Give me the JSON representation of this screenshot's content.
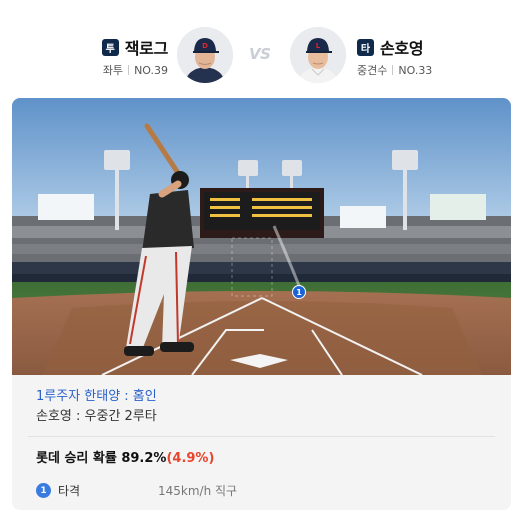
{
  "matchup": {
    "pitcher": {
      "role": "투",
      "name": "잭로그",
      "position": "좌투",
      "number": "NO.39",
      "cap_color": "#1b2a4a"
    },
    "vs": "VS",
    "batter": {
      "role": "타",
      "name": "손호영",
      "position": "중견수",
      "number": "NO.33",
      "cap_color": "#1b2a4a"
    }
  },
  "play": {
    "runner_text": "1루주자 한태양 : 홈인",
    "result_text": "손호영 : 우중간 2루타",
    "win_prob_label": "롯데 승리 확률 89.2%",
    "win_prob_delta": "(4.9%)",
    "pitch_marker": "1",
    "pitch": {
      "number": "1",
      "result": "타격",
      "info": "145km/h 직구"
    }
  },
  "colors": {
    "accent": "#2a62c9",
    "delta": "#e8452c",
    "badge": "#102a4c"
  }
}
